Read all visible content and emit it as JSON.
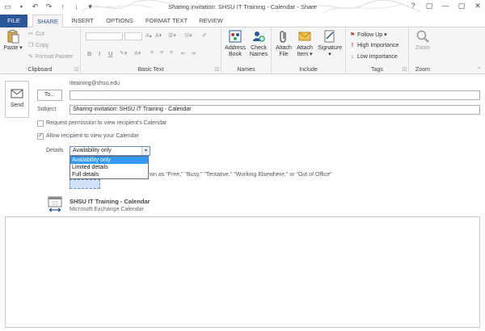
{
  "window": {
    "title": "Sharing invitation: SHSU IT Training - Calendar - Share",
    "controls": [
      "?",
      "▢",
      "—",
      "▢",
      "✕"
    ]
  },
  "tabs": [
    {
      "label": "FILE"
    },
    {
      "label": "SHARE"
    },
    {
      "label": "INSERT"
    },
    {
      "label": "OPTIONS"
    },
    {
      "label": "FORMAT TEXT"
    },
    {
      "label": "REVIEW"
    }
  ],
  "ribbon": {
    "clipboard": {
      "label": "Clipboard",
      "paste": "Paste",
      "cut": "Cut",
      "copy": "Copy",
      "format_painter": "Format Painter"
    },
    "basic_text": {
      "label": "Basic Text",
      "bold": "B",
      "italic": "I",
      "underline": "U"
    },
    "names": {
      "label": "Names",
      "address_book": [
        "Address",
        "Book"
      ],
      "check_names": [
        "Check",
        "Names"
      ]
    },
    "include": {
      "label": "Include",
      "attach_file": [
        "Attach",
        "File"
      ],
      "attach_item": [
        "Attach",
        "Item ▾"
      ],
      "signature": [
        "Signature",
        "▾"
      ]
    },
    "tags": {
      "label": "Tags",
      "follow_up": "Follow Up ▾",
      "high": "High Importance",
      "low": "Low Importance"
    },
    "zoom": {
      "label": "Zoom",
      "zoom": "Zoom"
    }
  },
  "compose": {
    "from": "ittraining@shsu.edu",
    "send": "Send",
    "to_button": "To...",
    "to_value": "",
    "subject_label": "Subject",
    "subject_value": "Sharing invitation: SHSU IT Training - Calendar",
    "request_permission": "Request permission to view recipient's Calendar",
    "allow_view": "Allow recipient to view your Calendar",
    "details_label": "Details",
    "details_value": "Availability only",
    "details_options": [
      "Availability only",
      "Limited details",
      "Full details"
    ],
    "behind_text": "wn as \"Free,\" \"Busy,\" \"Tentative,\" \"Working Elsewhere,\" or \"Out of Office\"",
    "calendar_name": "SHSU IT Training - Calendar",
    "calendar_sub": "Microsoft Exchange Calendar"
  },
  "colors": {
    "accent": "#2b579a",
    "selection": "#3399ff"
  }
}
